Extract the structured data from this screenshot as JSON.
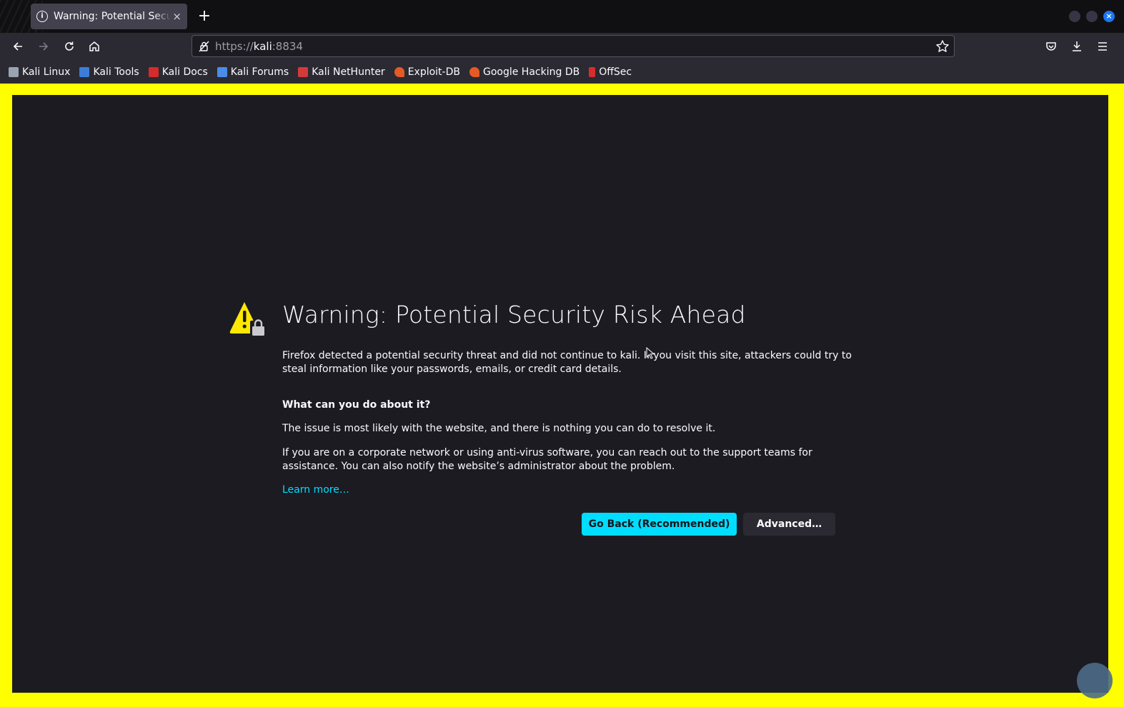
{
  "tab": {
    "title": "Warning: Potential Security Risk Ahead",
    "close": "×",
    "new_tab": "+"
  },
  "window": {
    "close": "×"
  },
  "navbar": {
    "url_scheme": "https://",
    "url_host": "kali",
    "url_port": ":8834"
  },
  "bookmarks": [
    {
      "label": "Kali Linux",
      "icon": "kali-dragon-icon",
      "color": "#9aa4b1"
    },
    {
      "label": "Kali Tools",
      "icon": "kali-tools-icon",
      "color": "#3d7dd8"
    },
    {
      "label": "Kali Docs",
      "icon": "kali-docs-icon",
      "color": "#d42b2b"
    },
    {
      "label": "Kali Forums",
      "icon": "kali-forums-icon",
      "color": "#4b8ce8"
    },
    {
      "label": "Kali NetHunter",
      "icon": "nethunter-icon",
      "color": "#d53a3a"
    },
    {
      "label": "Exploit-DB",
      "icon": "exploit-db-icon",
      "color": "#e55a26"
    },
    {
      "label": "Google Hacking DB",
      "icon": "ghdb-icon",
      "color": "#e55a26"
    },
    {
      "label": "OffSec",
      "icon": "offsec-icon",
      "color": "#d62d2d"
    }
  ],
  "page": {
    "title": "Warning: Potential Security Risk Ahead",
    "p1": "Firefox detected a potential security threat and did not continue to kali. If you visit this site, attackers could try to steal information like your passwords, emails, or credit card details.",
    "p2": "What can you do about it?",
    "p3": "The issue is most likely with the website, and there is nothing you can do to resolve it.",
    "p4": "If you are on a corporate network or using anti-virus software, you can reach out to the support teams for assistance. You can also notify the website’s administrator about the problem.",
    "learn_more": "Learn more…",
    "back_button": "Go Back (Recommended)",
    "advanced_button": "Advanced…"
  },
  "colors": {
    "accent": "#00ddff",
    "frame": "#ffff00",
    "warning": "#ffe900",
    "background": "#1c1b22"
  }
}
